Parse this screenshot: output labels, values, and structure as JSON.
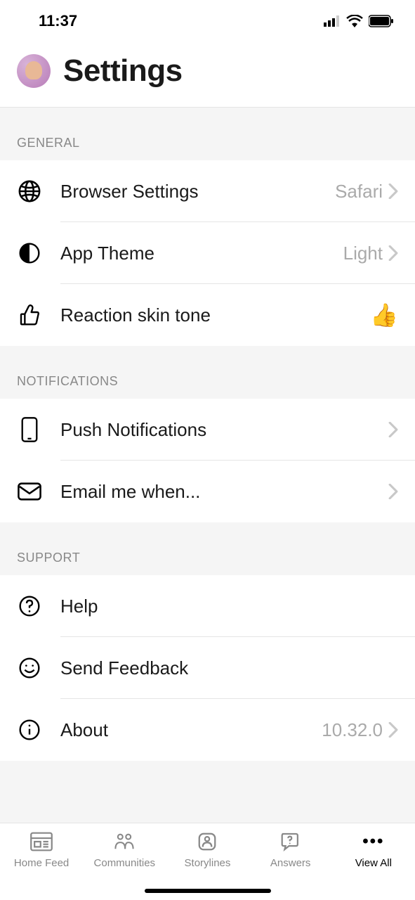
{
  "status": {
    "time": "11:37"
  },
  "header": {
    "title": "Settings"
  },
  "sections": {
    "general": {
      "title": "GENERAL",
      "browser": {
        "label": "Browser Settings",
        "value": "Safari"
      },
      "theme": {
        "label": "App Theme",
        "value": "Light"
      },
      "reaction": {
        "label": "Reaction skin tone",
        "emoji": "👍"
      }
    },
    "notifications": {
      "title": "NOTIFICATIONS",
      "push": {
        "label": "Push Notifications"
      },
      "email": {
        "label": "Email me when..."
      }
    },
    "support": {
      "title": "SUPPORT",
      "help": {
        "label": "Help"
      },
      "feedback": {
        "label": "Send Feedback"
      },
      "about": {
        "label": "About",
        "value": "10.32.0"
      }
    }
  },
  "tabs": {
    "home": "Home Feed",
    "communities": "Communities",
    "storylines": "Storylines",
    "answers": "Answers",
    "viewall": "View All"
  }
}
